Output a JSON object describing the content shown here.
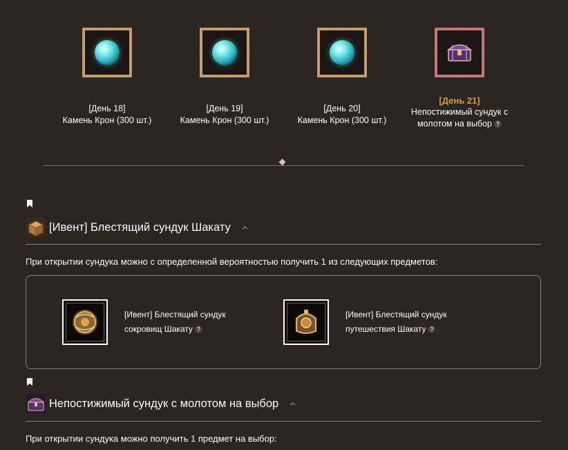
{
  "days": [
    {
      "label": "[День 18]",
      "reward": "Камень Крон (300 шт.)",
      "icon": "crown-stone-orb-icon"
    },
    {
      "label": "[День 19]",
      "reward": "Камень Крон (300 шт.)",
      "icon": "crown-stone-orb-icon"
    },
    {
      "label": "[День 20]",
      "reward": "Камень Крон (300 шт.)",
      "icon": "crown-stone-orb-icon"
    },
    {
      "label": "[День 21]",
      "reward_line1": "Непостижимый сундук с",
      "reward_line2": "молотом на выбор",
      "help": "?",
      "icon": "purple-chest-icon"
    }
  ],
  "sections": [
    {
      "title": "[Ивент] Блестящий сундук Шакату",
      "description": "При открытии сундука можно с определенной вероятностью получить 1 из следующих предметов:",
      "items": [
        {
          "line1": "[Ивент] Блестящий сундук",
          "line2": "сокровищ Шакату",
          "help": "?"
        },
        {
          "line1": "[Ивент] Блестящий сундук",
          "line2": "путешествия Шакату",
          "help": "?"
        }
      ]
    },
    {
      "title": "Непостижимый сундук с молотом на выбор",
      "description": "При открытии сундука можно получить 1 предмет на выбор:"
    }
  ],
  "colors": {
    "background": "#2b2522",
    "gold": "#d39a3c",
    "frame_gold": "#c69c6d",
    "frame_rose": "#c57676"
  }
}
